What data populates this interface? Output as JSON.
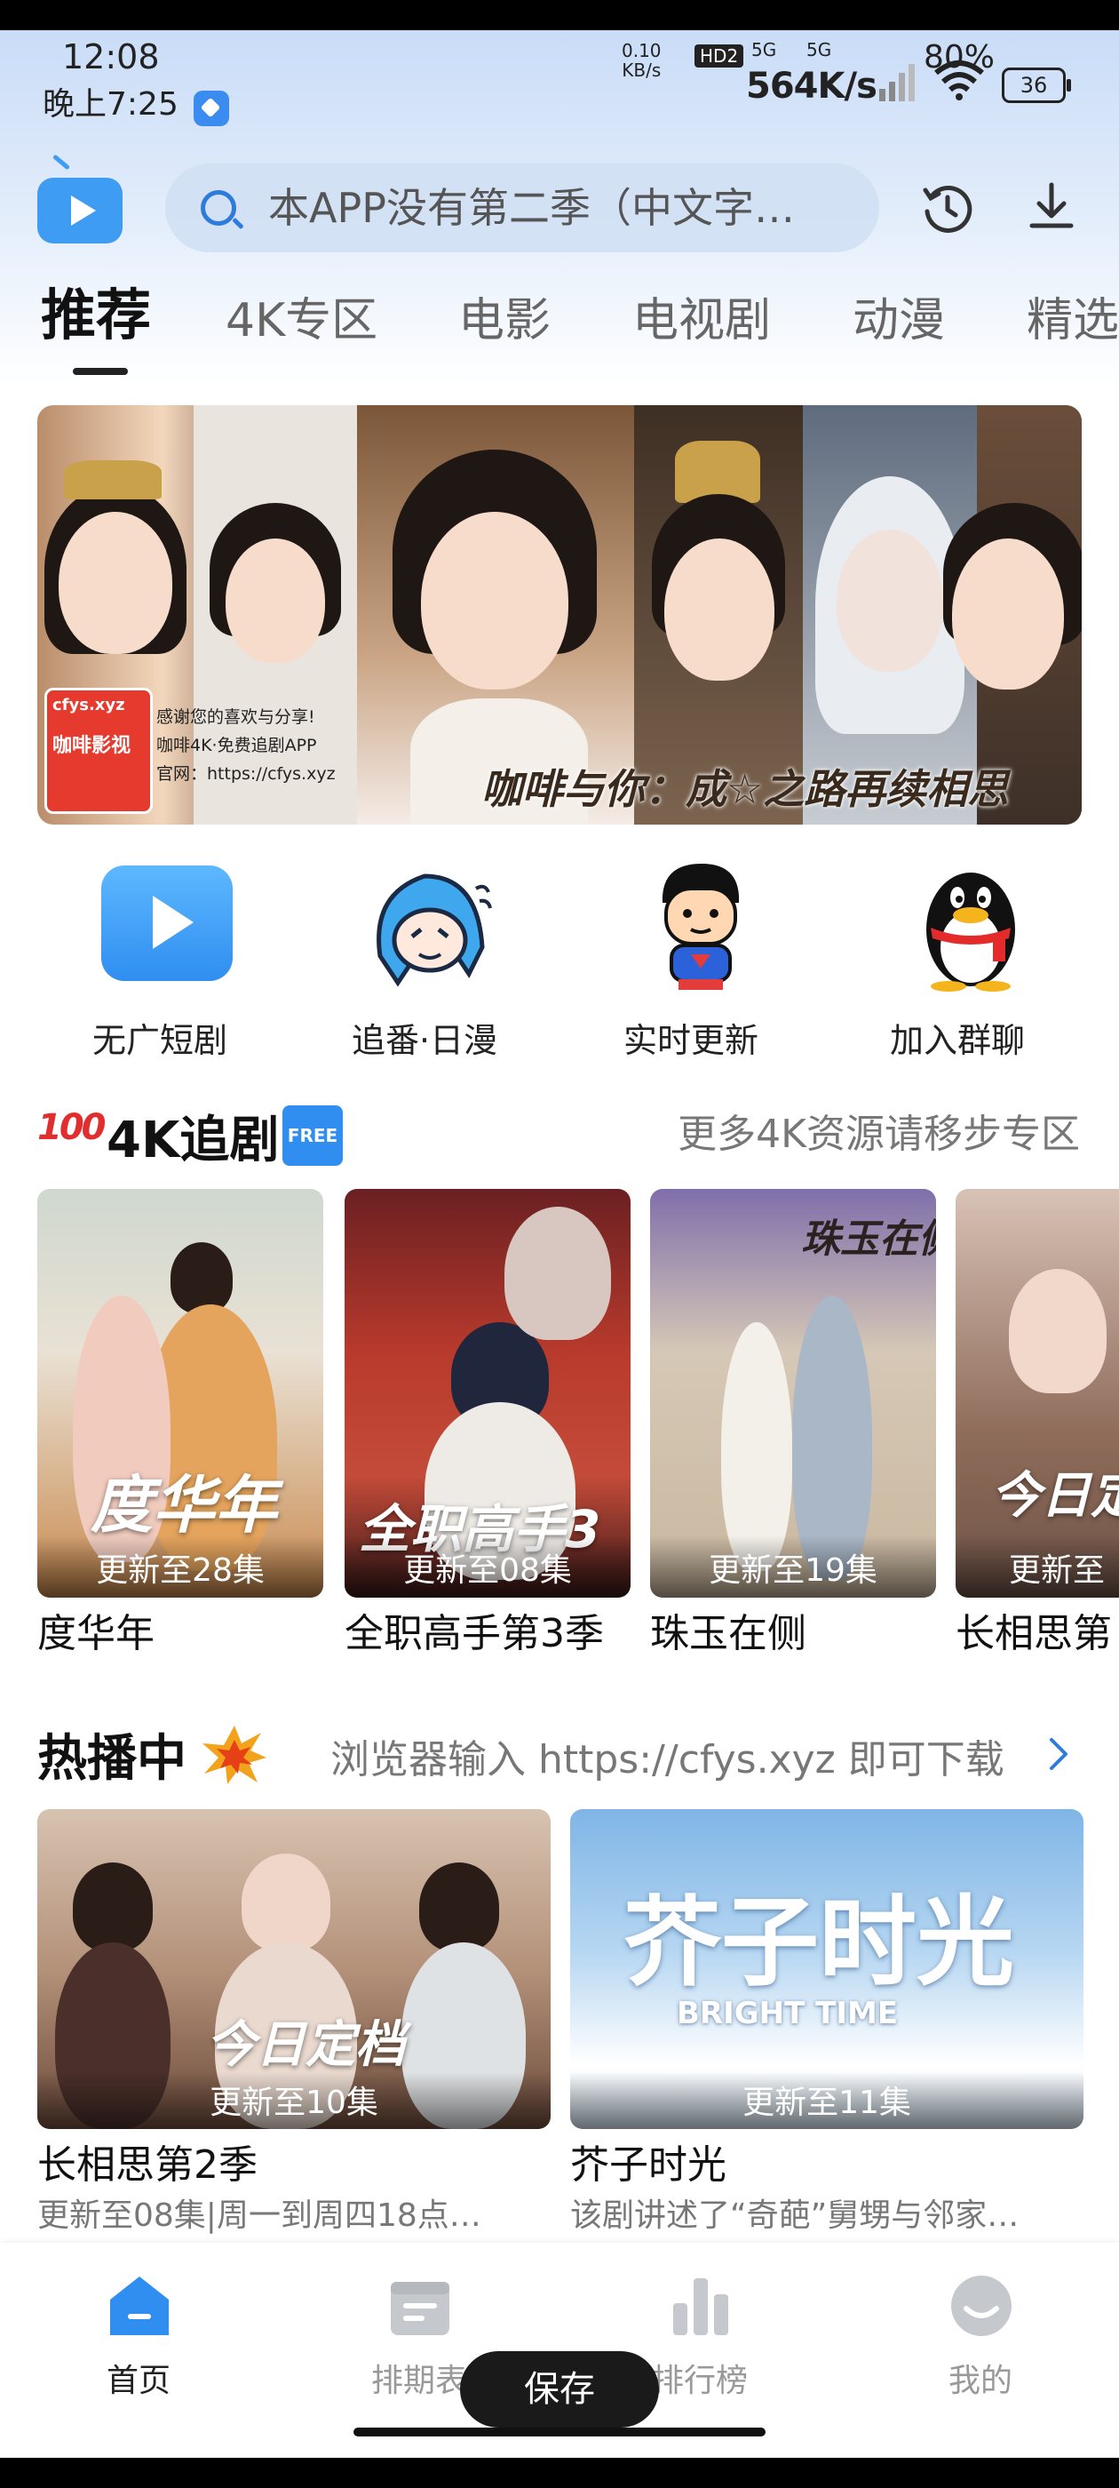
{
  "status_bar": {
    "time": "12:08",
    "time_secondary": "晚上7:25",
    "speed_value": "0.10",
    "speed_unit": "KB/s",
    "hd_label": "HD2",
    "net1": "5G",
    "net2": "5G",
    "net_speed": "564K/s",
    "battery_pct": "80%",
    "battery_level": "36"
  },
  "search": {
    "placeholder": "本APP没有第二季（中文字…"
  },
  "tabs": [
    {
      "label": "推荐",
      "active": true
    },
    {
      "label": "4K专区"
    },
    {
      "label": "电影"
    },
    {
      "label": "电视剧"
    },
    {
      "label": "动漫"
    },
    {
      "label": "精选"
    }
  ],
  "banner": {
    "app_brand": "咖啡影视",
    "logo_domain": "cfys.xyz",
    "tag_line1": "感谢您的喜欢与分享!",
    "tag_line2": "咖啡4K·免费追剧APP",
    "tag_line3": "官网：https://cfys.xyz",
    "slogan": "咖啡与你：成☆之路再续相思"
  },
  "quick_nav": [
    {
      "label": "无广短剧",
      "icon": "tv-play-icon"
    },
    {
      "label": "追番·日漫",
      "icon": "anime-girl-icon"
    },
    {
      "label": "实时更新",
      "icon": "superman-icon"
    },
    {
      "label": "加入群聊",
      "icon": "qq-penguin-icon"
    }
  ],
  "section_4k": {
    "title": "4K追剧",
    "badge": "FREE",
    "prefix_emoji": "100",
    "more": "更多4K资源请移步专区",
    "items": [
      {
        "title": "度华年",
        "update": "更新至28集",
        "art": "度华年"
      },
      {
        "title": "全职高手第3季",
        "update": "更新至08集",
        "art": "全职高手3"
      },
      {
        "title": "珠玉在侧",
        "update": "更新至19集",
        "art": "珠玉在侧"
      },
      {
        "title": "长相思第",
        "update": "更新至",
        "art": "今日定"
      }
    ]
  },
  "section_hot": {
    "title": "热播中",
    "more": "浏览器输入 https://cfys.xyz 即可下载",
    "items": [
      {
        "title": "长相思第2季",
        "update": "更新至10集",
        "desc": "更新至08集|周一到周四18点…",
        "art": "今日定档"
      },
      {
        "title": "芥子时光",
        "update": "更新至11集",
        "desc": "该剧讲述了“奇葩”舅甥与邻家…",
        "art": "芥子时光",
        "art_sub": "BRIGHT TIME"
      }
    ]
  },
  "bottom_nav": [
    {
      "label": "首页",
      "icon": "home-icon",
      "active": true
    },
    {
      "label": "排期表",
      "icon": "calendar-icon"
    },
    {
      "label": "排行榜",
      "icon": "rank-icon"
    },
    {
      "label": "我的",
      "icon": "profile-icon"
    }
  ],
  "toast": {
    "label": "保存"
  }
}
